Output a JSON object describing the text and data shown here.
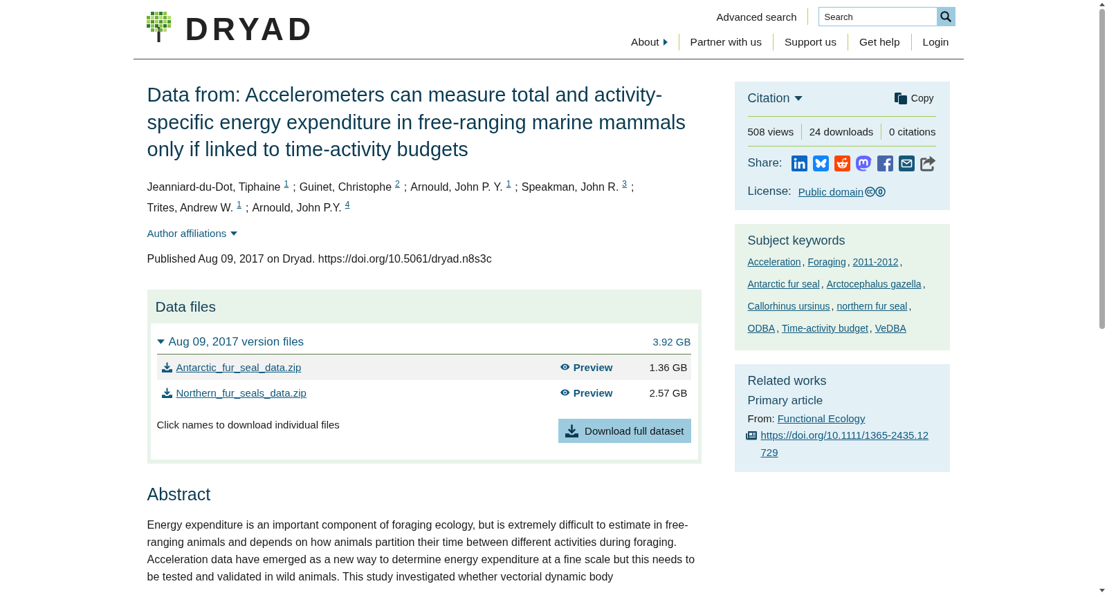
{
  "header": {
    "logo": "DRYAD",
    "advanced_search": "Advanced search",
    "search": {
      "placeholder": "Search"
    },
    "nav": [
      {
        "label": "About",
        "kind": "menu"
      },
      {
        "label": "Partner with us",
        "kind": "link"
      },
      {
        "label": "Support us",
        "kind": "link"
      },
      {
        "label": "Get help",
        "kind": "link"
      },
      {
        "label": "Login",
        "kind": "link"
      }
    ]
  },
  "dataset": {
    "title": "Data from: Accelerometers can measure total and activity-specific energy expenditure in free-ranging marine mammals only if linked to time-activity budgets",
    "author_separator": ";",
    "authors": [
      {
        "name": "Jeanniard-du-Dot, Tiphaine",
        "affiliation": "1"
      },
      {
        "name": "Guinet, Christophe",
        "affiliation": "2"
      },
      {
        "name": "Arnould, John P. Y.",
        "affiliation": "1"
      },
      {
        "name": "Speakman, John R.",
        "affiliation": "3"
      },
      {
        "name": "Trites, Andrew W.",
        "affiliation": "1"
      },
      {
        "name": "Arnould, John P.Y.",
        "affiliation": "4"
      }
    ],
    "affiliations_toggle": "Author affiliations",
    "published": "Published Aug 09, 2017 on Dryad. https://doi.org/10.5061/dryad.n8s3c"
  },
  "data_files": {
    "title": "Data files",
    "versions": [
      {
        "label": "Aug 09, 2017 version files",
        "size": "3.92 GB",
        "expanded": true,
        "files": [
          {
            "name": "Antarctic_fur_seal_data.zip",
            "action": "Preview",
            "size": "1.36 GB"
          },
          {
            "name": "Northern_fur_seals_data.zip",
            "action": "Preview",
            "size": "2.57 GB"
          }
        ]
      }
    ],
    "note": "Click names to download individual files",
    "download_button": "Download full dataset"
  },
  "abstract": {
    "title": "Abstract",
    "text": "Energy expenditure is an important component of foraging ecology, but is extremely difficult to estimate in free-ranging animals and depends on how animals partition their time between different activities during foraging. Acceleration data have emerged as a new way to determine energy expenditure at a fine scale but this needs to be tested and validated in wild animals. This study investigated whether vectorial dynamic body"
  },
  "sidebar": {
    "citation": {
      "title": "Citation",
      "copy_button": "Copy",
      "metrics": [
        "508 views",
        "24 downloads",
        "0 citations"
      ],
      "share_label": "Share:",
      "license_label": "License:",
      "license": "Public domain"
    },
    "keywords": {
      "title": "Subject keywords",
      "separator": ",",
      "items": [
        "Acceleration",
        "Foraging",
        "2011-2012",
        "Antarctic fur seal",
        "Arctocephalus gazella",
        "Callorhinus ursinus",
        "northern fur seal",
        "ODBA",
        "Time-activity budget",
        "VeDBA"
      ]
    },
    "related_works": {
      "title": "Related works",
      "items": [
        {
          "heading": "Primary article",
          "source_label": "From:",
          "source": "Functional Ecology",
          "doi": "https://doi.org/10.1111/1365-2435.12729"
        }
      ]
    }
  }
}
